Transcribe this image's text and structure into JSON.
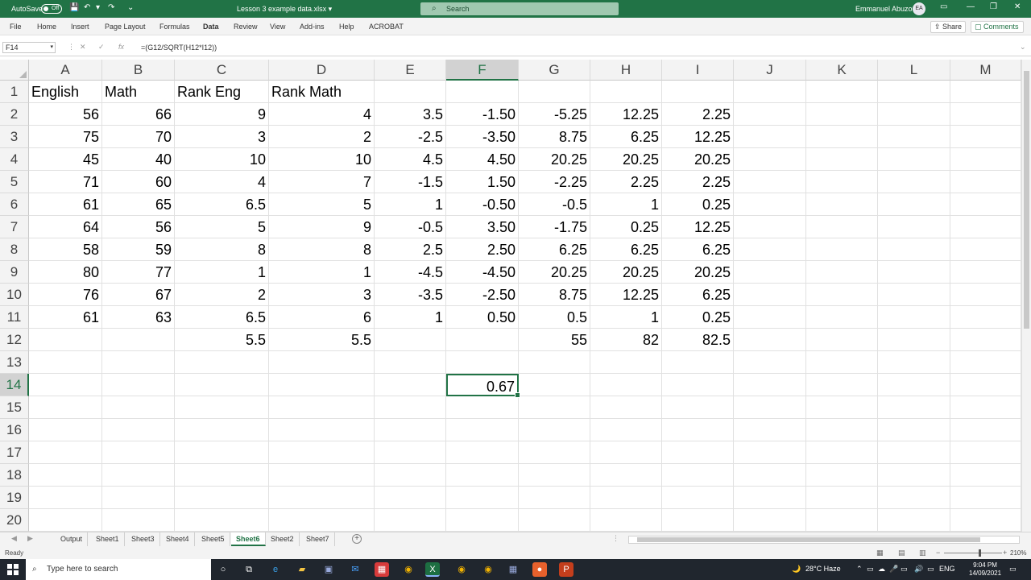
{
  "titlebar": {
    "autosave": "AutoSave",
    "autosave_state": "Off",
    "doc_title": "Lesson 3 example data.xlsx",
    "search_placeholder": "Search",
    "username": "Emmanuel Abuzo",
    "avatar": "EA"
  },
  "ribbon": {
    "tabs": [
      "File",
      "Home",
      "Insert",
      "Page Layout",
      "Formulas",
      "Data",
      "Review",
      "View",
      "Add-ins",
      "Help",
      "ACROBAT"
    ],
    "active_tab": "Data",
    "share": "Share",
    "comments": "Comments"
  },
  "formula_bar": {
    "name_box": "F14",
    "fx": "fx",
    "formula": "=(G12/SQRT(H12*I12))"
  },
  "sheet": {
    "selected_col": "F",
    "selected_row": 14,
    "columns": [
      "A",
      "B",
      "C",
      "D",
      "E",
      "F",
      "G",
      "H",
      "I",
      "J",
      "K",
      "L",
      "M"
    ],
    "rows": [
      1,
      2,
      3,
      4,
      5,
      6,
      7,
      8,
      9,
      10,
      11,
      12,
      13,
      14,
      15,
      16,
      17,
      18,
      19,
      20
    ],
    "cells": {
      "A1": "English",
      "B1": "Math",
      "C1": "Rank Eng",
      "D1": "Rank Math",
      "A2": "56",
      "B2": "66",
      "C2": "9",
      "D2": "4",
      "E2": "3.5",
      "F2": "-1.50",
      "G2": "-5.25",
      "H2": "12.25",
      "I2": "2.25",
      "A3": "75",
      "B3": "70",
      "C3": "3",
      "D3": "2",
      "E3": "-2.5",
      "F3": "-3.50",
      "G3": "8.75",
      "H3": "6.25",
      "I3": "12.25",
      "A4": "45",
      "B4": "40",
      "C4": "10",
      "D4": "10",
      "E4": "4.5",
      "F4": "4.50",
      "G4": "20.25",
      "H4": "20.25",
      "I4": "20.25",
      "A5": "71",
      "B5": "60",
      "C5": "4",
      "D5": "7",
      "E5": "-1.5",
      "F5": "1.50",
      "G5": "-2.25",
      "H5": "2.25",
      "I5": "2.25",
      "A6": "61",
      "B6": "65",
      "C6": "6.5",
      "D6": "5",
      "E6": "1",
      "F6": "-0.50",
      "G6": "-0.5",
      "H6": "1",
      "I6": "0.25",
      "A7": "64",
      "B7": "56",
      "C7": "5",
      "D7": "9",
      "E7": "-0.5",
      "F7": "3.50",
      "G7": "-1.75",
      "H7": "0.25",
      "I7": "12.25",
      "A8": "58",
      "B8": "59",
      "C8": "8",
      "D8": "8",
      "E8": "2.5",
      "F8": "2.50",
      "G8": "6.25",
      "H8": "6.25",
      "I8": "6.25",
      "A9": "80",
      "B9": "77",
      "C9": "1",
      "D9": "1",
      "E9": "-4.5",
      "F9": "-4.50",
      "G9": "20.25",
      "H9": "20.25",
      "I9": "20.25",
      "A10": "76",
      "B10": "67",
      "C10": "2",
      "D10": "3",
      "E10": "-3.5",
      "F10": "-2.50",
      "G10": "8.75",
      "H10": "12.25",
      "I10": "6.25",
      "A11": "61",
      "B11": "63",
      "C11": "6.5",
      "D11": "6",
      "E11": "1",
      "F11": "0.50",
      "G11": "0.5",
      "H11": "1",
      "I11": "0.25",
      "C12": "5.5",
      "D12": "5.5",
      "G12": "55",
      "H12": "82",
      "I12": "82.5",
      "F14": "0.67"
    },
    "text_cells": [
      "A1",
      "B1",
      "C1",
      "D1"
    ]
  },
  "sheet_tabs": {
    "tabs": [
      "Output",
      "Sheet1",
      "Sheet3",
      "Sheet4",
      "Sheet5",
      "Sheet6",
      "Sheet2",
      "Sheet7"
    ],
    "active": "Sheet6"
  },
  "status": {
    "ready": "Ready",
    "zoom": "210%"
  },
  "taskbar": {
    "search_placeholder": "Type here to search",
    "weather": "28°C  Haze",
    "lang": "ENG",
    "time": "9:04 PM",
    "date": "14/09/2021"
  }
}
